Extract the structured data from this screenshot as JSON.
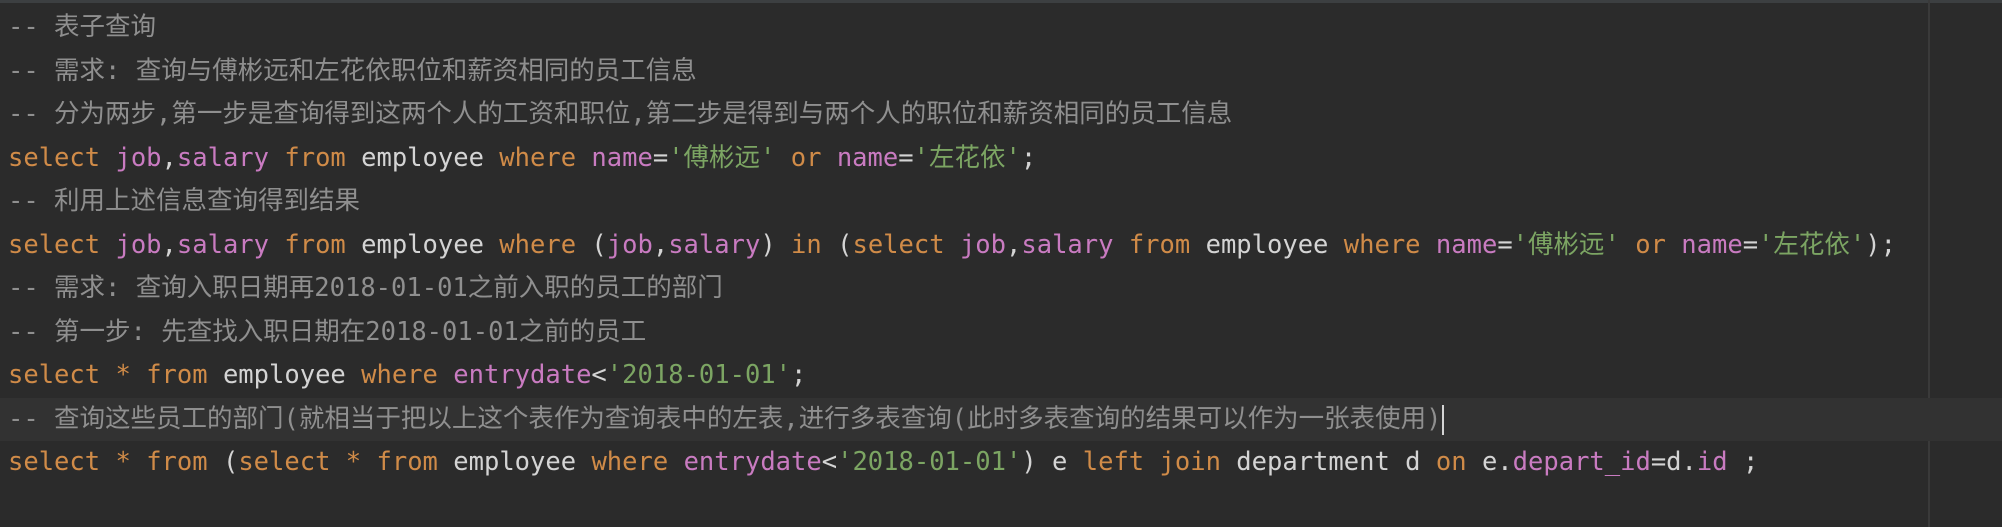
{
  "editor": {
    "lines": [
      {
        "segments": [
          {
            "cls": "cmt",
            "text": "-- 表子查询"
          }
        ]
      },
      {
        "segments": [
          {
            "cls": "cmt",
            "text": "-- 需求: 查询与傅彬远和左花依职位和薪资相同的员工信息"
          }
        ]
      },
      {
        "segments": [
          {
            "cls": "cmt",
            "text": "-- 分为两步,第一步是查询得到这两个人的工资和职位,第二步是得到与两个人的职位和薪资相同的员工信息"
          }
        ]
      },
      {
        "segments": [
          {
            "cls": "kw",
            "text": "select "
          },
          {
            "cls": "col",
            "text": "job"
          },
          {
            "cls": "txt",
            "text": ","
          },
          {
            "cls": "col",
            "text": "salary "
          },
          {
            "cls": "kw",
            "text": "from "
          },
          {
            "cls": "txt",
            "text": "employee "
          },
          {
            "cls": "kw",
            "text": "where "
          },
          {
            "cls": "col",
            "text": "name"
          },
          {
            "cls": "txt",
            "text": "="
          },
          {
            "cls": "str",
            "text": "'傅彬远' "
          },
          {
            "cls": "kw",
            "text": "or "
          },
          {
            "cls": "col",
            "text": "name"
          },
          {
            "cls": "txt",
            "text": "="
          },
          {
            "cls": "str",
            "text": "'左花依'"
          },
          {
            "cls": "txt",
            "text": ";"
          }
        ]
      },
      {
        "segments": [
          {
            "cls": "cmt",
            "text": "-- 利用上述信息查询得到结果"
          }
        ]
      },
      {
        "segments": [
          {
            "cls": "kw",
            "text": "select "
          },
          {
            "cls": "col",
            "text": "job"
          },
          {
            "cls": "txt",
            "text": ","
          },
          {
            "cls": "col",
            "text": "salary "
          },
          {
            "cls": "kw",
            "text": "from "
          },
          {
            "cls": "txt",
            "text": "employee "
          },
          {
            "cls": "kw",
            "text": "where "
          },
          {
            "cls": "txt",
            "text": "("
          },
          {
            "cls": "col",
            "text": "job"
          },
          {
            "cls": "txt",
            "text": ","
          },
          {
            "cls": "col",
            "text": "salary"
          },
          {
            "cls": "txt",
            "text": ") "
          },
          {
            "cls": "kw",
            "text": "in "
          },
          {
            "cls": "txt",
            "text": "("
          },
          {
            "cls": "kw",
            "text": "select "
          },
          {
            "cls": "col",
            "text": "job"
          },
          {
            "cls": "txt",
            "text": ","
          },
          {
            "cls": "col",
            "text": "salary "
          },
          {
            "cls": "kw",
            "text": "from "
          },
          {
            "cls": "txt",
            "text": "employee "
          },
          {
            "cls": "kw",
            "text": "where "
          },
          {
            "cls": "col",
            "text": "name"
          },
          {
            "cls": "txt",
            "text": "="
          },
          {
            "cls": "str",
            "text": "'傅彬远' "
          },
          {
            "cls": "kw",
            "text": "or "
          },
          {
            "cls": "col",
            "text": "name"
          },
          {
            "cls": "txt",
            "text": "="
          },
          {
            "cls": "str",
            "text": "'左花依'"
          },
          {
            "cls": "txt",
            "text": ");"
          }
        ]
      },
      {
        "segments": [
          {
            "cls": "cmt",
            "text": "-- 需求: 查询入职日期再2018-01-01之前入职的员工的部门"
          }
        ]
      },
      {
        "segments": [
          {
            "cls": "cmt",
            "text": "-- 第一步: 先查找入职日期在2018-01-01之前的员工"
          }
        ]
      },
      {
        "segments": [
          {
            "cls": "kw",
            "text": "select "
          },
          {
            "cls": "kw",
            "text": "* "
          },
          {
            "cls": "kw",
            "text": "from "
          },
          {
            "cls": "txt",
            "text": "employee "
          },
          {
            "cls": "kw",
            "text": "where "
          },
          {
            "cls": "col",
            "text": "entrydate"
          },
          {
            "cls": "txt",
            "text": "<"
          },
          {
            "cls": "str",
            "text": "'2018-01-01'"
          },
          {
            "cls": "txt",
            "text": ";"
          }
        ]
      },
      {
        "active": true,
        "caret": true,
        "segments": [
          {
            "cls": "cmt",
            "text": "-- 查询这些员工的部门(就相当于把以上这个表作为查询表中的左表,进行多表查询(此时多表查询的结果可以作为一张表使用)"
          }
        ]
      },
      {
        "segments": [
          {
            "cls": "kw",
            "text": "select "
          },
          {
            "cls": "kw",
            "text": "* "
          },
          {
            "cls": "kw",
            "text": "from "
          },
          {
            "cls": "txt",
            "text": "("
          },
          {
            "cls": "kw",
            "text": "select "
          },
          {
            "cls": "kw",
            "text": "* "
          },
          {
            "cls": "kw",
            "text": "from "
          },
          {
            "cls": "txt",
            "text": "employee "
          },
          {
            "cls": "kw",
            "text": "where "
          },
          {
            "cls": "col",
            "text": "entrydate"
          },
          {
            "cls": "txt",
            "text": "<"
          },
          {
            "cls": "str",
            "text": "'2018-01-01'"
          },
          {
            "cls": "txt",
            "text": ") e "
          },
          {
            "cls": "kw",
            "text": "left join "
          },
          {
            "cls": "txt",
            "text": "department d "
          },
          {
            "cls": "kw",
            "text": "on "
          },
          {
            "cls": "txt",
            "text": "e."
          },
          {
            "cls": "col",
            "text": "depart_id"
          },
          {
            "cls": "txt",
            "text": "=d."
          },
          {
            "cls": "col",
            "text": "id "
          },
          {
            "cls": "txt",
            "text": ";"
          }
        ]
      }
    ]
  }
}
